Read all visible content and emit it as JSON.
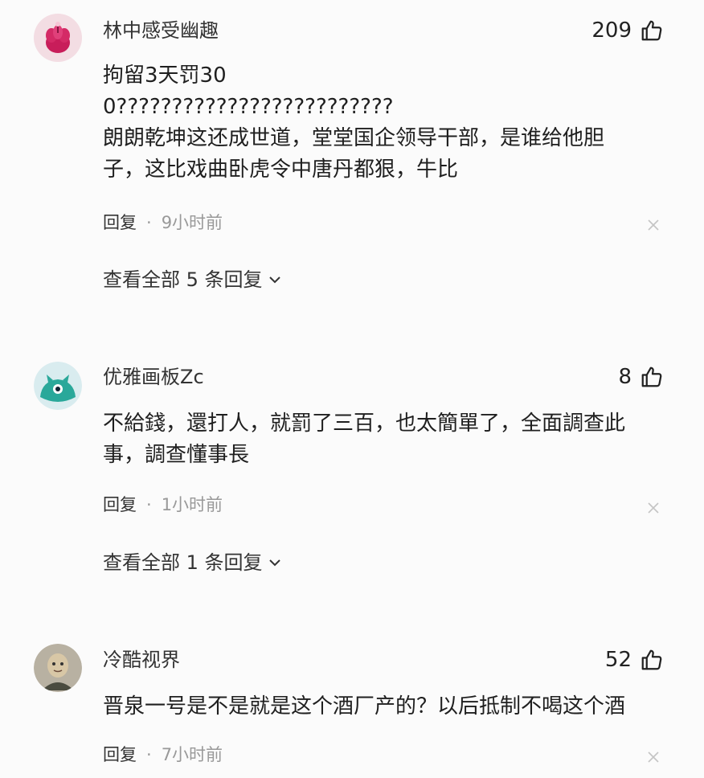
{
  "comments": [
    {
      "username": "林中感受幽趣",
      "likes": "209",
      "text": "拘留3天罚30\n0?????????????????????????\n朗朗乾坤这还成世道，堂堂国企领导干部，是谁给他胆\n子，这比戏曲卧虎令中唐丹都狠，牛比",
      "reply_label": "回复",
      "dot": "·",
      "time": "9小时前",
      "view_all": "查看全部 5 条回复",
      "avatar_icon": "lotus-avatar-icon"
    },
    {
      "username": "优雅画板Zc",
      "likes": "8",
      "text": "不給錢，還打人，就罰了三百，也太簡單了，全面調查此\n事，調查懂事長",
      "reply_label": "回复",
      "dot": "·",
      "time": "1小时前",
      "view_all": "查看全部 1 条回复",
      "avatar_icon": "teal-creature-avatar-icon"
    },
    {
      "username": "冷酷视界",
      "likes": "52",
      "text": "晋泉一号是不是就是这个酒厂产的？以后抵制不喝这个酒",
      "reply_label": "回复",
      "dot": "·",
      "time": "7小时前",
      "avatar_icon": "photo-avatar-icon"
    }
  ],
  "colors": {
    "background": "#fbfbfb",
    "text": "#1f1f1f",
    "muted": "#999999"
  }
}
